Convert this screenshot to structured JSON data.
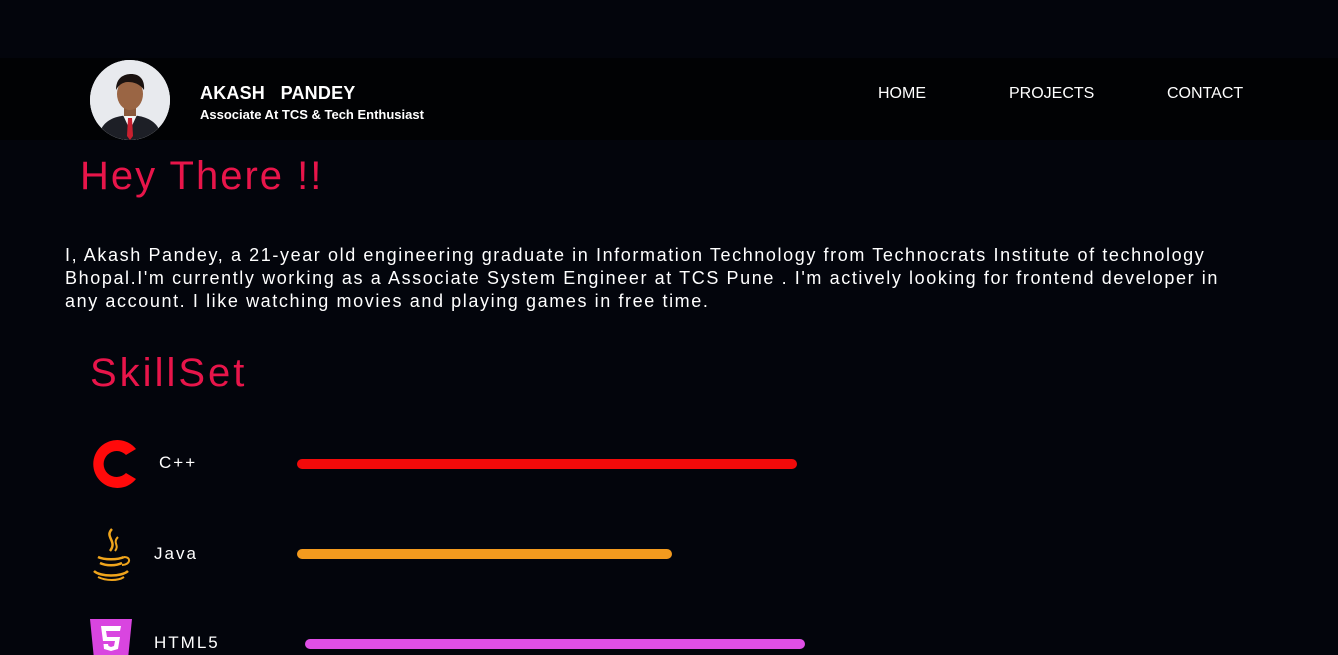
{
  "header": {
    "name": "AKASH   PANDEY",
    "subtitle": "Associate At TCS & Tech Enthusiast",
    "nav": {
      "home": "HOME",
      "projects": "PROJECTS",
      "contact": "CONTACT"
    }
  },
  "intro": {
    "greeting": "Hey There !!",
    "about": "I, Akash Pandey, a 21-year old engineering graduate in Information Technology from Technocrats Institute of technology Bhopal.I'm currently working as a Associate System Engineer at TCS Pune . I'm actively looking for frontend developer in any account. I like watching movies and playing games in free time."
  },
  "skills": {
    "title": "SkillSet",
    "items": [
      {
        "label": "C++",
        "icon": "c-plus-plus-icon",
        "color": "#f20a0a",
        "level": 1.0
      },
      {
        "label": "Java",
        "icon": "java-icon",
        "color": "#f39a1e",
        "level": 0.75
      },
      {
        "label": "HTML5",
        "icon": "html5-icon",
        "color": "#e04fe6",
        "level": 1.0
      }
    ]
  },
  "colors": {
    "background": "#03050c",
    "accent": "#e8154a"
  }
}
